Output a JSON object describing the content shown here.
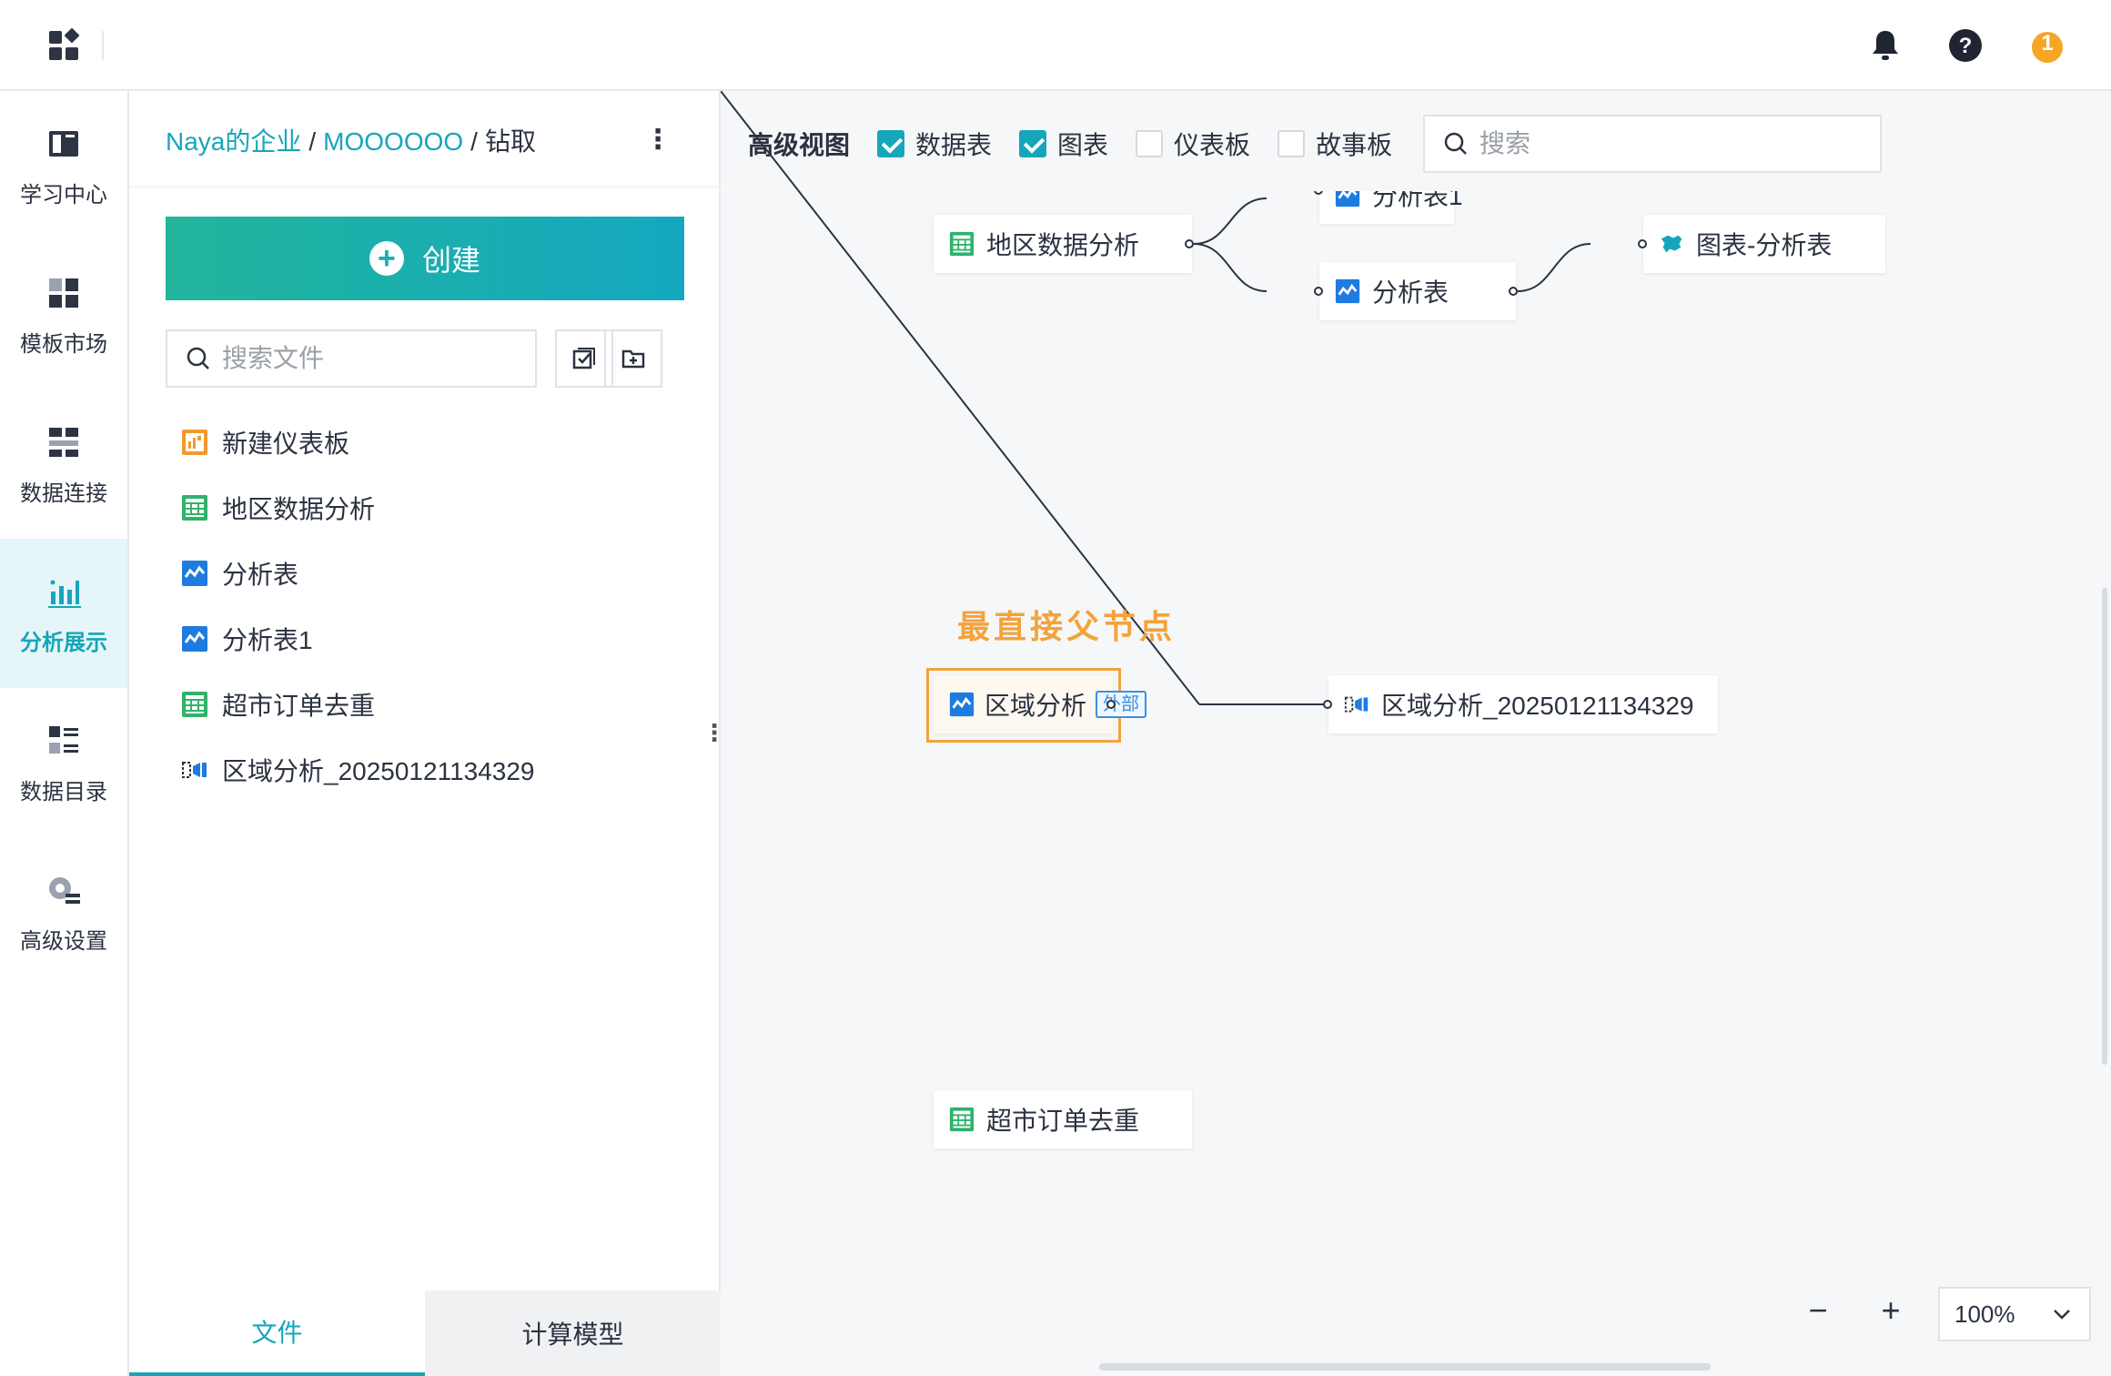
{
  "topbar": {
    "icons": [
      "apps-grid-icon",
      "bell-icon",
      "help-icon",
      "notice-badge-icon"
    ],
    "badge_text": "1"
  },
  "sidebar": {
    "items": [
      {
        "label": "学习中心",
        "icon": "learning-book-icon",
        "active": false
      },
      {
        "label": "模板市场",
        "icon": "template-grid-icon",
        "active": false
      },
      {
        "label": "数据连接",
        "icon": "data-connection-icon",
        "active": false
      },
      {
        "label": "分析展示",
        "icon": "bar-chart-icon",
        "active": true
      },
      {
        "label": "数据目录",
        "icon": "catalog-list-icon",
        "active": false
      },
      {
        "label": "高级设置",
        "icon": "settings-gear-icon",
        "active": false
      }
    ]
  },
  "panel": {
    "breadcrumb": {
      "root": "Naya的企业",
      "sep1": "/",
      "project": "MOOOOOO",
      "sep2": "/",
      "current": "钻取"
    },
    "menu_glyph": "⋮",
    "create_label": "创建",
    "search_placeholder": "搜索文件",
    "files": [
      {
        "name": "新建仪表板",
        "icon": "dashboard-icon"
      },
      {
        "name": "地区数据分析",
        "icon": "table-icon"
      },
      {
        "name": "分析表",
        "icon": "analysis-icon"
      },
      {
        "name": "分析表1",
        "icon": "analysis-icon"
      },
      {
        "name": "超市订单去重",
        "icon": "table-icon"
      },
      {
        "name": "区域分析_20250121134329",
        "icon": "drill-icon"
      }
    ],
    "tabs": {
      "files": "文件",
      "models": "计算模型"
    }
  },
  "canvas": {
    "title": "高级视图",
    "filters": [
      {
        "label": "数据表",
        "checked": true
      },
      {
        "label": "图表",
        "checked": true
      },
      {
        "label": "仪表板",
        "checked": false
      },
      {
        "label": "故事板",
        "checked": false
      }
    ],
    "search_placeholder": "搜索",
    "nodes": {
      "region_data": "地区数据分析",
      "analysis1": "分析表1",
      "analysis": "分析表",
      "chart_analysis": "图表-分析表",
      "region_analysis": "区域分析",
      "external_tag": "外部",
      "region_drill": "区域分析_20250121134329",
      "supermarket": "超市订单去重"
    },
    "highlight_label": "最直接父节点",
    "highlight_color": "#f3a33a",
    "zoom": {
      "minus": "−",
      "plus": "+",
      "value": "100%"
    }
  },
  "colors": {
    "accent": "#16a6bb",
    "table_green": "#2fb36b",
    "analysis_blue": "#1e7be0",
    "dashboard_orange": "#f29a2e"
  }
}
